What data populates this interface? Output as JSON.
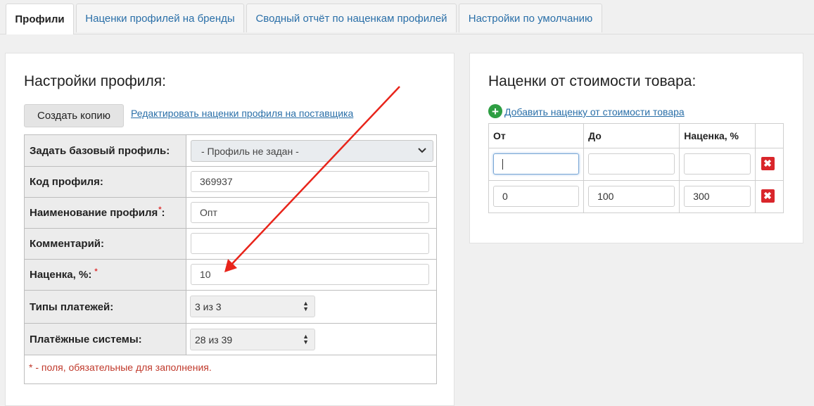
{
  "tabs": [
    {
      "label": "Профили"
    },
    {
      "label": "Наценки профилей на бренды"
    },
    {
      "label": "Сводный отчёт по наценкам профилей"
    },
    {
      "label": "Настройки по умолчанию"
    }
  ],
  "profile": {
    "title": "Настройки профиля:",
    "copy_button": "Создать копию",
    "edit_link": "Редактировать наценки профиля на поставщика",
    "rows": {
      "base_profile": {
        "label": "Задать базовый профиль:",
        "value": "- Профиль не задан -"
      },
      "code": {
        "label": "Код профиля:",
        "value": "369937"
      },
      "name": {
        "label": "Наименование профиля",
        "required_mark": "*",
        "suffix": ":",
        "value": "Опт"
      },
      "comment": {
        "label": "Комментарий:",
        "value": ""
      },
      "markup": {
        "label": "Наценка, %:",
        "required_mark": "*",
        "value": "10"
      },
      "payment_types": {
        "label": "Типы платежей:",
        "value": "3 из 3"
      },
      "payment_systems": {
        "label": "Платёжные системы:",
        "value": "28 из 39"
      }
    },
    "required_note": "* - поля, обязательные для заполнения."
  },
  "markups": {
    "title": "Наценки от стоимости товара:",
    "add_link": "Добавить наценку от стоимости товара",
    "headers": {
      "from": "От",
      "to": "До",
      "markup": "Наценка, %"
    },
    "rows": [
      {
        "from": "",
        "to": "",
        "markup": "",
        "focused": true
      },
      {
        "from": "0",
        "to": "100",
        "markup": "300",
        "focused": false
      }
    ],
    "delete_symbol": "✖"
  },
  "colors": {
    "link": "#2a6fa8",
    "required": "#d33",
    "delete": "#d9262b",
    "add": "#2e9e43",
    "arrow": "#e8241a"
  }
}
